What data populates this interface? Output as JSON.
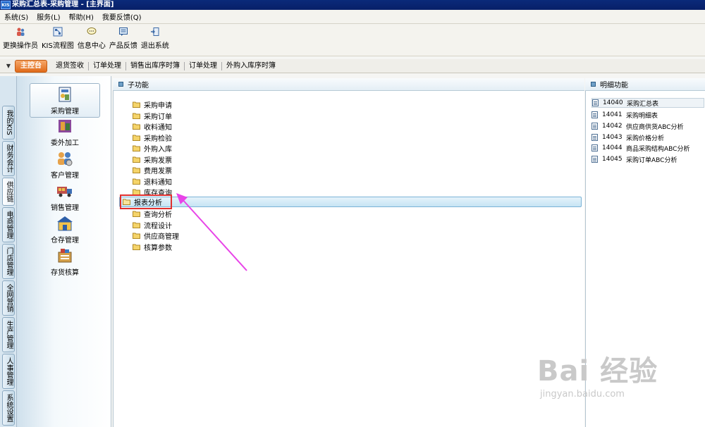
{
  "window": {
    "title": "采购汇总表-采购管理 - [主界面]",
    "logo": "KIS"
  },
  "menu": [
    "系统(S)",
    "服务(L)",
    "帮助(H)",
    "我要反馈(Q)"
  ],
  "toolbar": [
    {
      "label": "更换操作员",
      "icon": "switch-user-icon"
    },
    {
      "label": "KIS流程图",
      "icon": "flowchart-icon"
    },
    {
      "label": "信息中心",
      "icon": "message-icon"
    },
    {
      "label": "产品反馈",
      "icon": "feedback-icon"
    },
    {
      "label": "退出系统",
      "icon": "exit-icon"
    }
  ],
  "tabs": [
    "主控台",
    "退货签收",
    "订单处理",
    "销售出库序时簿",
    "订单处理",
    "外购入库序时簿"
  ],
  "side_tabs": [
    "我的KIS",
    "财务会计",
    "供应链",
    "电商管理",
    "门店管理",
    "全网营销",
    "生产管理",
    "人事管理",
    "系统设置"
  ],
  "categories": [
    {
      "label": "采购管理",
      "icon": "purchase-icon"
    },
    {
      "label": "委外加工",
      "icon": "outsourcing-icon"
    },
    {
      "label": "客户管理",
      "icon": "customer-icon"
    },
    {
      "label": "销售管理",
      "icon": "sales-truck-icon"
    },
    {
      "label": "仓存管理",
      "icon": "warehouse-icon"
    },
    {
      "label": "存货核算",
      "icon": "inventory-accounting-icon"
    }
  ],
  "sub_panel": {
    "title": "子功能",
    "items": [
      "采购申请",
      "采购订单",
      "收料通知",
      "采购检验",
      "外购入库",
      "采购发票",
      "费用发票",
      "退料通知",
      "库存查询",
      "报表分析",
      "查询分析",
      "流程设计",
      "供应商管理",
      "核算参数"
    ],
    "selected": "报表分析"
  },
  "detail_panel": {
    "title": "明细功能",
    "items": [
      {
        "code": "14040",
        "name": "采购汇总表"
      },
      {
        "code": "14041",
        "name": "采购明细表"
      },
      {
        "code": "14042",
        "name": "供应商供货ABC分析"
      },
      {
        "code": "14043",
        "name": "采购价格分析"
      },
      {
        "code": "14044",
        "name": "商品采购结构ABC分析"
      },
      {
        "code": "14045",
        "name": "采购订单ABC分析"
      }
    ]
  },
  "watermark": {
    "brand": "Bai 经验",
    "site": "jingyan.baidu.com"
  },
  "colors": {
    "annotation_arrow": "#e844e8",
    "highlight_box": "#e0302f",
    "active_tab": "#e06a1a"
  }
}
